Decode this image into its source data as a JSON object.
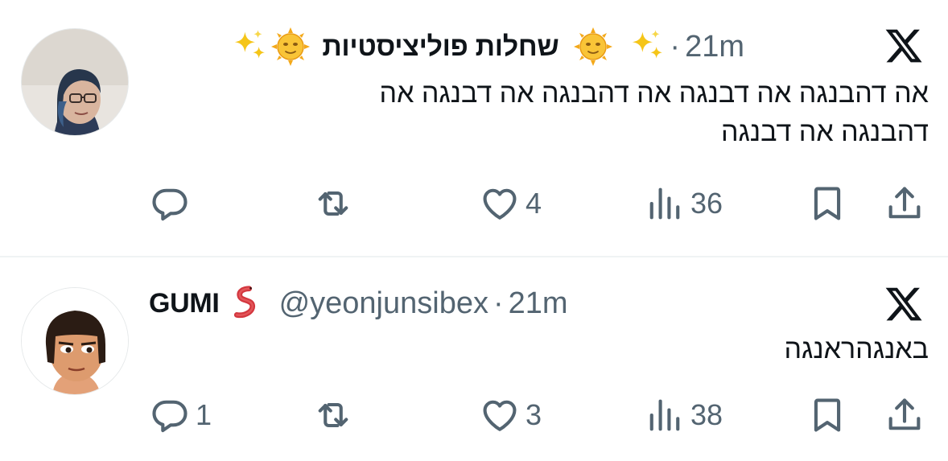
{
  "tweets": [
    {
      "display_name": "שחלות פוליציסטיות",
      "name_decorations": [
        "sparkles",
        "sun-with-face"
      ],
      "separator": "·",
      "time": "21m",
      "text_line1": "אה דהבנגה אה דבנגה אה דהבנגה אה דבנגה אה",
      "text_line2": "דהבנגה אה דבנגה",
      "replies": "",
      "likes": "4",
      "views": "36"
    },
    {
      "display_name": "GUMI",
      "name_decoration": "worm",
      "handle": "@yeonjunsibex",
      "separator": "·",
      "time": "21m",
      "text_line1": "באנגהראנגה",
      "replies": "1",
      "likes": "3",
      "views": "38"
    }
  ],
  "icons": [
    "x-logo-icon",
    "reply-icon",
    "retweet-icon",
    "like-icon",
    "views-icon",
    "bookmark-icon",
    "share-icon"
  ],
  "colors": {
    "text": "#0f1419",
    "secondary": "#536471",
    "divider": "#eff3f4"
  }
}
